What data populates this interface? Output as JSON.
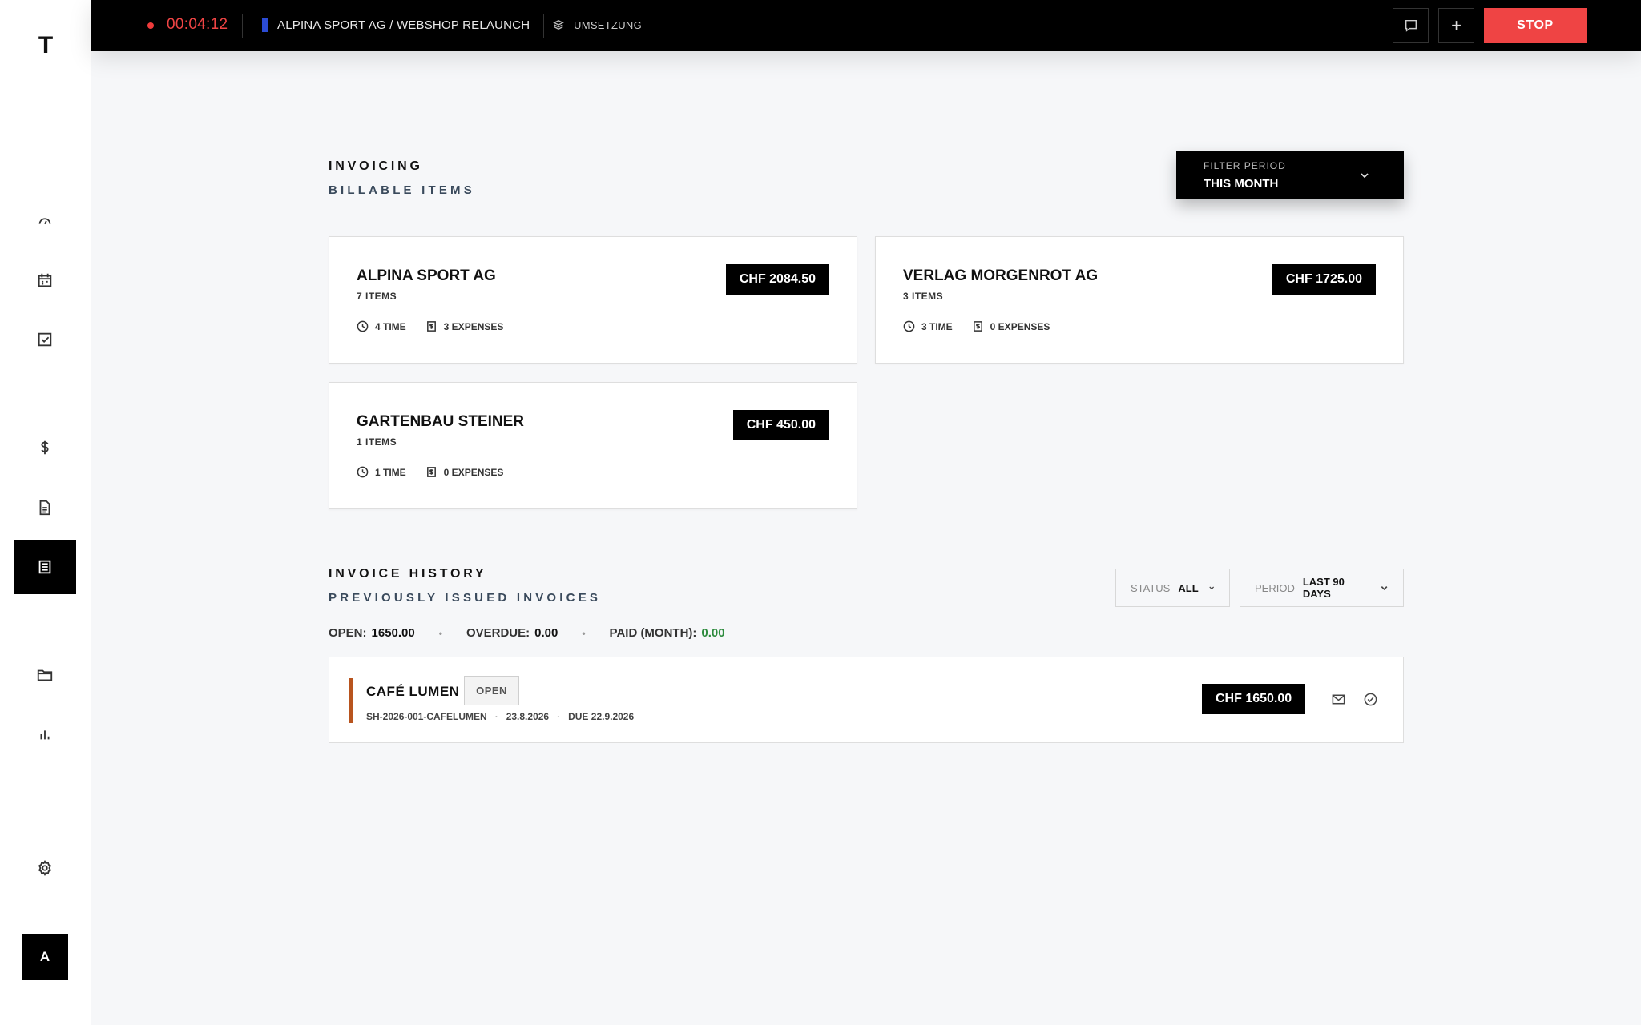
{
  "app": {
    "logo": "T"
  },
  "sidebar": {
    "items": [
      {
        "name": "dashboard",
        "icon": "gauge-icon",
        "active": false
      },
      {
        "name": "calendar",
        "icon": "calendar-icon",
        "active": false
      },
      {
        "name": "tasks",
        "icon": "checkbox-icon",
        "active": false
      },
      {
        "name": "billing",
        "icon": "dollar-icon",
        "active": false
      },
      {
        "name": "documents",
        "icon": "document-icon",
        "active": false
      },
      {
        "name": "invoices",
        "icon": "invoice-icon",
        "active": true
      },
      {
        "name": "projects",
        "icon": "folder-icon",
        "active": false
      },
      {
        "name": "reports",
        "icon": "bar-chart-icon",
        "active": false
      },
      {
        "name": "settings",
        "icon": "gear-icon",
        "active": false
      }
    ],
    "avatar": "A"
  },
  "topbar": {
    "timer": "00:04:12",
    "project_title": "ALPINA SPORT AG / WEBSHOP RELAUNCH",
    "project_color": "#2b4bd4",
    "task": "UMSETZUNG",
    "add_label": "+",
    "stop_label": "STOP"
  },
  "invoicing": {
    "title": "INVOICING",
    "subtitle": "BILLABLE ITEMS",
    "filter": {
      "label": "FILTER PERIOD",
      "value": "THIS MONTH"
    },
    "clients": [
      {
        "name": "ALPINA SPORT AG",
        "items": "7 ITEMS",
        "time": "4 TIME",
        "expenses": "3 EXPENSES",
        "amount": "CHF 2084.50"
      },
      {
        "name": "VERLAG MORGENROT AG",
        "items": "3 ITEMS",
        "time": "3 TIME",
        "expenses": "0 EXPENSES",
        "amount": "CHF 1725.00"
      },
      {
        "name": "GARTENBAU STEINER",
        "items": "1 ITEMS",
        "time": "1 TIME",
        "expenses": "0 EXPENSES",
        "amount": "CHF 450.00"
      }
    ]
  },
  "history": {
    "title": "INVOICE HISTORY",
    "subtitle": "PREVIOUSLY ISSUED INVOICES",
    "status_filter": {
      "label": "STATUS",
      "value": "ALL"
    },
    "period_filter": {
      "label": "PERIOD",
      "value": "LAST 90 DAYS"
    },
    "summary": {
      "open_label": "OPEN:",
      "open_value": "1650.00",
      "overdue_label": "OVERDUE:",
      "overdue_value": "0.00",
      "paid_label": "PAID (MONTH):",
      "paid_value": "0.00"
    },
    "invoices": [
      {
        "client": "CAFÉ LUMEN",
        "status": "OPEN",
        "number": "SH-2026-001-CAFELUMEN",
        "date": "23.8.2026",
        "due": "DUE 22.9.2026",
        "amount": "CHF 1650.00",
        "status_color": "#b8541e"
      }
    ]
  },
  "colors": {
    "accent_red": "#ef4444",
    "paid_green": "#2e8b3e"
  }
}
